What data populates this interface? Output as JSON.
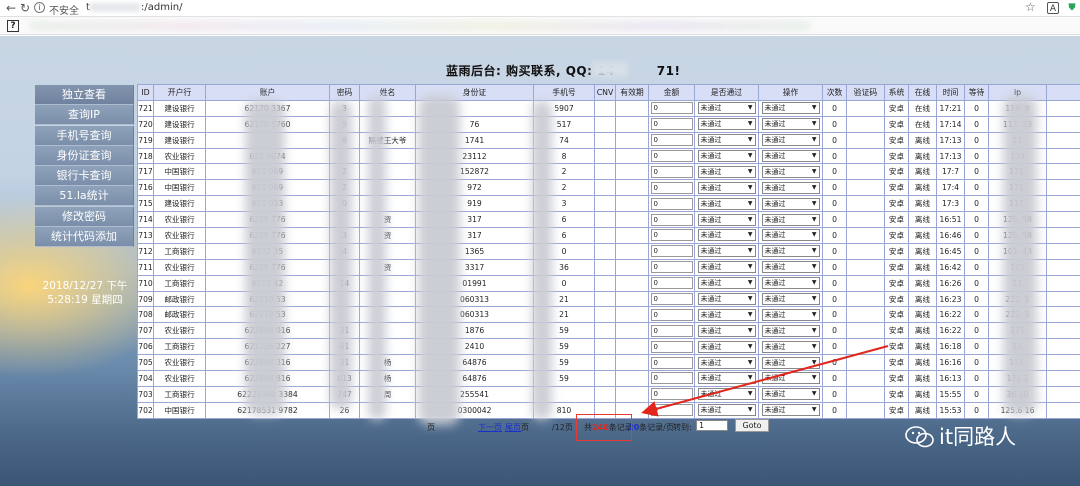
{
  "browser": {
    "security_label": "不安全",
    "url_prefix": "t",
    "url_suffix": ":/admin/"
  },
  "page": {
    "title": "蓝雨后台: 购买联系, QQ: 14",
    "title_suffix": "71!"
  },
  "sidebar": {
    "items": [
      {
        "label": "独立查看"
      },
      {
        "label": "查询IP"
      },
      {
        "label": "手机号查询"
      },
      {
        "label": "身份证查询"
      },
      {
        "label": "银行卡查询"
      },
      {
        "label": "51.la统计"
      },
      {
        "label": "修改密码"
      },
      {
        "label": "统计代码添加"
      }
    ],
    "datetime_line1": "2018/12/27 下午",
    "datetime_line2": "5:28:19 星期四"
  },
  "table": {
    "headers": [
      "ID",
      "开户行",
      "账户",
      "密码",
      "姓名",
      "身份证",
      "手机号",
      "CNV",
      "有效期",
      "金额",
      "是否通过",
      "操作",
      "次数",
      "验证码",
      "系统",
      "在线",
      "时间",
      "等待",
      "ip"
    ],
    "rows": [
      {
        "id": "721",
        "bank": "建设银行",
        "account": "62170       3367",
        "pwd": "  3",
        "name": "",
        "idcard": "        ",
        "phone": "        5907",
        "amount": "0",
        "pass": "未通过",
        "op": "未通过",
        "count": "0",
        "sys": "安卓",
        "online": "在线",
        "time": "17:21",
        "wait": "0",
        "ip": "119.        8"
      },
      {
        "id": "720",
        "bank": "建设银行",
        "account": "62170      5760",
        "pwd": "  5",
        "name": "",
        "idcard": "         76",
        "phone": "       517",
        "amount": "0",
        "pass": "未通过",
        "op": "未通过",
        "count": "0",
        "sys": "安卓",
        "online": "在线",
        "time": "17:14",
        "wait": "0",
        "ip": "117.        23"
      },
      {
        "id": "719",
        "bank": "建设银行",
        "account": "",
        "pwd": "  6",
        "name": "隔壁王大爷",
        "idcard": "        1741",
        "phone": "       74",
        "amount": "0",
        "pass": "未通过",
        "op": "未通过",
        "count": "0",
        "sys": "安卓",
        "online": "离线",
        "time": "17:13",
        "wait": "0",
        "ip": "11"
      },
      {
        "id": "718",
        "bank": "农业银行",
        "account": "622       0074",
        "pwd": "",
        "name": "",
        "idcard": "         23112",
        "phone": "       8",
        "amount": "0",
        "pass": "未通过",
        "op": "未通过",
        "count": "0",
        "sys": "安卓",
        "online": "离线",
        "time": "17:13",
        "wait": "0",
        "ip": "139"
      },
      {
        "id": "717",
        "bank": "中国银行",
        "account": "621       069",
        "pwd": " 2",
        "name": "",
        "idcard": "         152872",
        "phone": "       2",
        "amount": "0",
        "pass": "未通过",
        "op": "未通过",
        "count": "0",
        "sys": "安卓",
        "online": "离线",
        "time": "17:7",
        "wait": "0",
        "ip": "171."
      },
      {
        "id": "716",
        "bank": "中国银行",
        "account": "621       069",
        "pwd": " 2",
        "name": "",
        "idcard": "         972",
        "phone": "       2",
        "amount": "0",
        "pass": "未通过",
        "op": "未通过",
        "count": "0",
        "sys": "安卓",
        "online": "离线",
        "time": "17:4",
        "wait": "0",
        "ip": "171."
      },
      {
        "id": "715",
        "bank": "建设银行",
        "account": "621       033",
        "pwd": "  0",
        "name": "",
        "idcard": "         919",
        "phone": "       3",
        "amount": "0",
        "pass": "未通过",
        "op": "未通过",
        "count": "0",
        "sys": "安卓",
        "online": "离线",
        "time": "17:3",
        "wait": "0",
        "ip": "117."
      },
      {
        "id": "714",
        "bank": "农业银行",
        "account": "6228      776",
        "pwd": "",
        "name": "  资",
        "idcard": "        317",
        "phone": "       6",
        "amount": "0",
        "pass": "未通过",
        "op": "未通过",
        "count": "0",
        "sys": "安卓",
        "online": "离线",
        "time": "16:51",
        "wait": "0",
        "ip": "125.        58"
      },
      {
        "id": "713",
        "bank": "农业银行",
        "account": "6228      776",
        "pwd": "  3",
        "name": "  资",
        "idcard": "        317",
        "phone": "       6",
        "amount": "0",
        "pass": "未通过",
        "op": "未通过",
        "count": "0",
        "sys": "安卓",
        "online": "离线",
        "time": "16:46",
        "wait": "0",
        "ip": "125.        58"
      },
      {
        "id": "712",
        "bank": "工商银行",
        "account": "6222      35",
        "pwd": " 4",
        "name": "",
        "idcard": "        1365",
        "phone": "       0",
        "amount": "0",
        "pass": "未通过",
        "op": "未通过",
        "count": "0",
        "sys": "安卓",
        "online": "离线",
        "time": "16:45",
        "wait": "0",
        "ip": "101.        43"
      },
      {
        "id": "711",
        "bank": "农业银行",
        "account": "6228      776",
        "pwd": "",
        "name": "  资",
        "idcard": "        3317",
        "phone": "       36",
        "amount": "0",
        "pass": "未通过",
        "op": "未通过",
        "count": "0",
        "sys": "安卓",
        "online": "离线",
        "time": "16:42",
        "wait": "0",
        "ip": "125"
      },
      {
        "id": "710",
        "bank": "工商银行",
        "account": "6212      42",
        "pwd": " 14",
        "name": "",
        "idcard": "        01991",
        "phone": "       0",
        "amount": "0",
        "pass": "未通过",
        "op": "未通过",
        "count": "0",
        "sys": "安卓",
        "online": "离线",
        "time": "16:26",
        "wait": "0",
        "ip": "11"
      },
      {
        "id": "709",
        "bank": "邮政银行",
        "account": "62210      53",
        "pwd": "",
        "name": "",
        "idcard": "        060313",
        "phone": "       21",
        "amount": "0",
        "pass": "未通过",
        "op": "未通过",
        "count": "0",
        "sys": "安卓",
        "online": "离线",
        "time": "16:23",
        "wait": "0",
        "ip": "222.        5"
      },
      {
        "id": "708",
        "bank": "邮政银行",
        "account": "62218      53",
        "pwd": "",
        "name": "",
        "idcard": "        060313",
        "phone": "       21",
        "amount": "0",
        "pass": "未通过",
        "op": "未通过",
        "count": "0",
        "sys": "安卓",
        "online": "离线",
        "time": "16:22",
        "wait": "0",
        "ip": "222.        5"
      },
      {
        "id": "707",
        "bank": "农业银行",
        "account": "622848      016",
        "pwd": " 31",
        "name": "",
        "idcard": "        1876",
        "phone": "       59",
        "amount": "0",
        "pass": "未通过",
        "op": "未通过",
        "count": "0",
        "sys": "安卓",
        "online": "离线",
        "time": "16:22",
        "wait": "0",
        "ip": "171"
      },
      {
        "id": "706",
        "bank": "工商银行",
        "account": "621226      227",
        "pwd": " 41",
        "name": "",
        "idcard": "        2410",
        "phone": "       59",
        "amount": "0",
        "pass": "未通过",
        "op": "未通过",
        "count": "0",
        "sys": "安卓",
        "online": "离线",
        "time": "16:18",
        "wait": "0",
        "ip": "11"
      },
      {
        "id": "705",
        "bank": "农业银行",
        "account": "622848      316",
        "pwd": " 31",
        "name": "  杨",
        "idcard": "        64876",
        "phone": "       59",
        "amount": "0",
        "pass": "未通过",
        "op": "未通过",
        "count": "0",
        "sys": "安卓",
        "online": "离线",
        "time": "16:16",
        "wait": "0",
        "ip": "171."
      },
      {
        "id": "704",
        "bank": "农业银行",
        "account": "622848      816",
        "pwd": " 013",
        "name": "  杨",
        "idcard": "        64876",
        "phone": "       59",
        "amount": "0",
        "pass": "未通过",
        "op": "未通过",
        "count": "0",
        "sys": "安卓",
        "online": "离线",
        "time": "16:13",
        "wait": "0",
        "ip": "171.1"
      },
      {
        "id": "703",
        "bank": "工商银行",
        "account": "62222360      3384",
        "pwd": " 747",
        "name": "  周",
        "idcard": "        255541",
        "phone": "",
        "amount": "0",
        "pass": "未通过",
        "op": "未通过",
        "count": "0",
        "sys": "安卓",
        "online": "离线",
        "time": "15:55",
        "wait": "0",
        "ip": "36.10"
      },
      {
        "id": "702",
        "bank": "中国银行",
        "account": "62178531      9782",
        "pwd": " 26",
        "name": "",
        "idcard": "        0300042",
        "phone": "       810",
        "amount": "0",
        "pass": "未通过",
        "op": "未通过",
        "count": "0",
        "sys": "安卓",
        "online": "离线",
        "time": "15:53",
        "wait": "0",
        "ip": "125.6        16"
      }
    ]
  },
  "pager": {
    "page_label": "页",
    "next_label": "下一页",
    "last_label": "尾页",
    "page_fraction": "/12页",
    "total_prefix": "共",
    "total_count": "240",
    "total_suffix": "条记录",
    "per_page_count": "20",
    "per_page_suffix": "条记录/页",
    "goto_label": "转到:",
    "goto_value": "1",
    "goto_button": "Goto"
  },
  "watermark": {
    "text": "it同路人"
  },
  "colors": {
    "header_bg": "#d8def6",
    "table_border": "#9aa6d6",
    "sidebar_bg": "#7b8faa",
    "highlight_red": "#e2261b"
  }
}
